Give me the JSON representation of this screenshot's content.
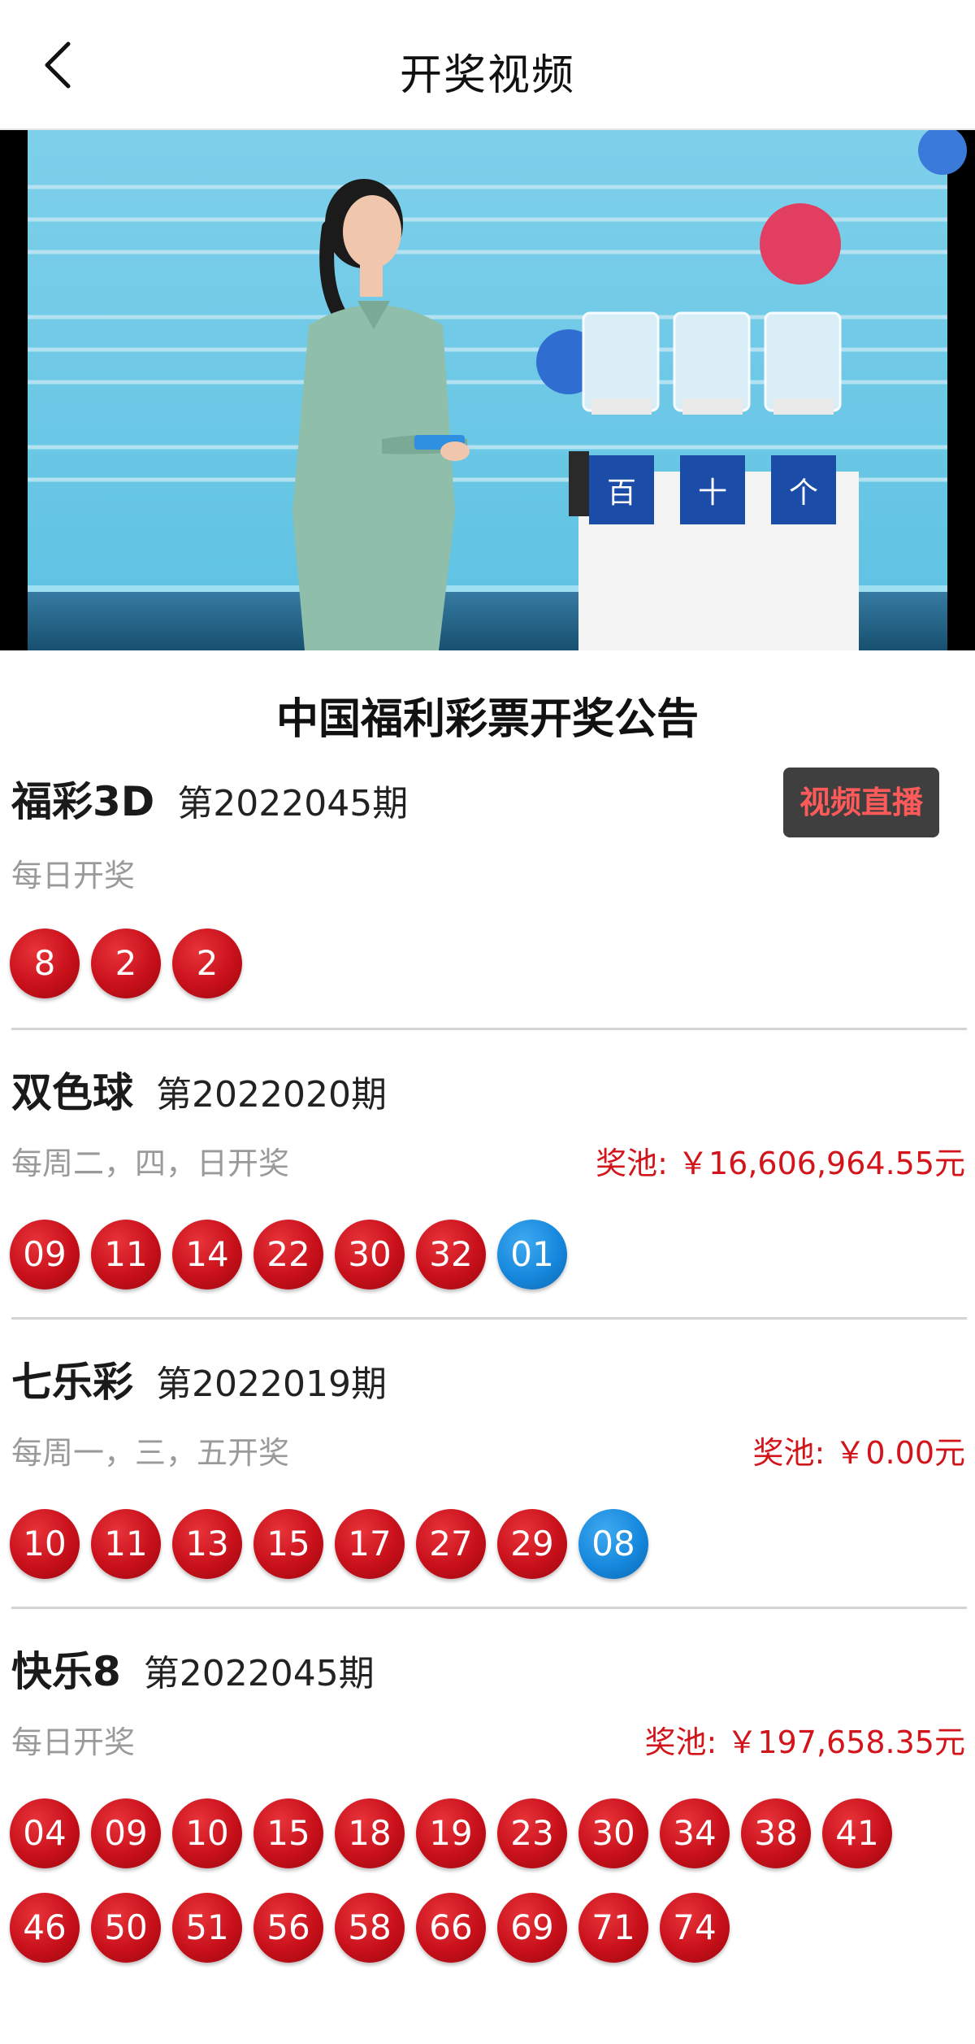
{
  "header": {
    "title": "开奖视频"
  },
  "announcement": "中国福利彩票开奖公告",
  "video": {
    "machine_labels": [
      "百",
      "十",
      "个"
    ]
  },
  "sections": [
    {
      "name": "福彩3D",
      "issue": "第2022045期",
      "schedule": "每日开奖",
      "live_button": "视频直播",
      "balls": [
        {
          "n": "8",
          "color": "red"
        },
        {
          "n": "2",
          "color": "red"
        },
        {
          "n": "2",
          "color": "red"
        }
      ]
    },
    {
      "name": "双色球",
      "issue": "第2022020期",
      "schedule": "每周二，四，日开奖",
      "pool": "奖池: ￥16,606,964.55元",
      "balls": [
        {
          "n": "09",
          "color": "red"
        },
        {
          "n": "11",
          "color": "red"
        },
        {
          "n": "14",
          "color": "red"
        },
        {
          "n": "22",
          "color": "red"
        },
        {
          "n": "30",
          "color": "red"
        },
        {
          "n": "32",
          "color": "red"
        },
        {
          "n": "01",
          "color": "blue"
        }
      ]
    },
    {
      "name": "七乐彩",
      "issue": "第2022019期",
      "schedule": "每周一，三，五开奖",
      "pool": "奖池: ￥0.00元",
      "balls": [
        {
          "n": "10",
          "color": "red"
        },
        {
          "n": "11",
          "color": "red"
        },
        {
          "n": "13",
          "color": "red"
        },
        {
          "n": "15",
          "color": "red"
        },
        {
          "n": "17",
          "color": "red"
        },
        {
          "n": "27",
          "color": "red"
        },
        {
          "n": "29",
          "color": "red"
        },
        {
          "n": "08",
          "color": "blue"
        }
      ]
    },
    {
      "name": "快乐8",
      "issue": "第2022045期",
      "schedule": "每日开奖",
      "pool": "奖池: ￥197,658.35元",
      "balls": [
        {
          "n": "04",
          "color": "red"
        },
        {
          "n": "09",
          "color": "red"
        },
        {
          "n": "10",
          "color": "red"
        },
        {
          "n": "15",
          "color": "red"
        },
        {
          "n": "18",
          "color": "red"
        },
        {
          "n": "19",
          "color": "red"
        },
        {
          "n": "23",
          "color": "red"
        },
        {
          "n": "30",
          "color": "red"
        },
        {
          "n": "34",
          "color": "red"
        },
        {
          "n": "38",
          "color": "red"
        },
        {
          "n": "41",
          "color": "red"
        },
        {
          "n": "46",
          "color": "red"
        },
        {
          "n": "50",
          "color": "red"
        },
        {
          "n": "51",
          "color": "red"
        },
        {
          "n": "56",
          "color": "red"
        },
        {
          "n": "58",
          "color": "red"
        },
        {
          "n": "66",
          "color": "red"
        },
        {
          "n": "69",
          "color": "red"
        },
        {
          "n": "71",
          "color": "red"
        },
        {
          "n": "74",
          "color": "red"
        }
      ]
    }
  ],
  "colors": {
    "red_ball": "#c8101a",
    "blue_ball": "#1688dd",
    "pool_text": "#d2141b",
    "live_button_bg": "#3f3f3f",
    "live_button_text": "#ff5a5a"
  }
}
